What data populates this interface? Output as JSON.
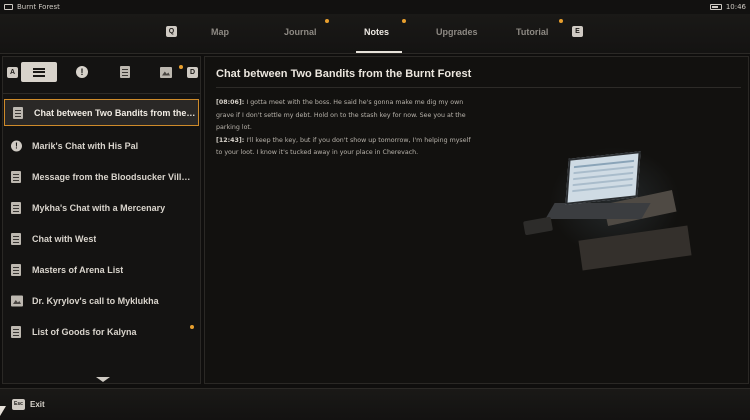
{
  "status_bar": {
    "location": "Burnt Forest",
    "time": "10:46"
  },
  "nav": {
    "left_key": "Q",
    "right_key": "E",
    "tabs": [
      {
        "label": "Map",
        "active": false,
        "badge": false
      },
      {
        "label": "Journal",
        "active": false,
        "badge": true
      },
      {
        "label": "Notes",
        "active": true,
        "badge": true
      },
      {
        "label": "Upgrades",
        "active": false,
        "badge": false
      },
      {
        "label": "Tutorial",
        "active": false,
        "badge": true
      }
    ]
  },
  "filters": {
    "left_key": "A",
    "right_key": "D",
    "items": [
      {
        "name": "all",
        "icon": "list-icon",
        "active": true
      },
      {
        "name": "important",
        "icon": "exclamation-icon",
        "active": false
      },
      {
        "name": "notes",
        "icon": "note-icon",
        "active": false
      },
      {
        "name": "images",
        "icon": "photo-icon",
        "active": false,
        "badge": true
      }
    ],
    "exclamation_glyph": "!"
  },
  "notes": [
    {
      "title": "Chat between Two Bandits from the Burnt Forest",
      "icon": "note-icon",
      "selected": true,
      "badge": false
    },
    {
      "title": "Marik's Chat with His Pal",
      "icon": "exclamation-icon",
      "selected": false,
      "badge": false
    },
    {
      "title": "Message from the Bloodsucker Village",
      "icon": "note-icon",
      "selected": false,
      "badge": false
    },
    {
      "title": "Mykha's Chat with a Mercenary",
      "icon": "note-icon",
      "selected": false,
      "badge": false
    },
    {
      "title": "Chat with West",
      "icon": "note-icon",
      "selected": false,
      "badge": false
    },
    {
      "title": "Masters of Arena List",
      "icon": "note-icon",
      "selected": false,
      "badge": false
    },
    {
      "title": "Dr. Kyrylov's call to Myklukha",
      "icon": "photo-icon",
      "selected": false,
      "badge": false
    },
    {
      "title": "List of Goods for Kalyna",
      "icon": "note-icon",
      "selected": false,
      "badge": true
    }
  ],
  "detail": {
    "title": "Chat between Two Bandits from the Burnt Forest",
    "messages": [
      {
        "time": "[08:06]:",
        "text": " I gotta meet with the boss. He said he's gonna make me dig my own grave if I don't settle my debt. Hold on to the stash key for now. See you at the parking lot."
      },
      {
        "time": "[12:43]:",
        "text": " I'll keep the key, but if you don't show up tomorrow, I'm helping myself to your loot. I know it's tucked away in your place in Cherevach."
      }
    ]
  },
  "footer": {
    "exit_key": "Esc",
    "exit_label": "Exit"
  },
  "colors": {
    "accent": "#e89f2e",
    "selection_border": "#cf8b2a"
  }
}
